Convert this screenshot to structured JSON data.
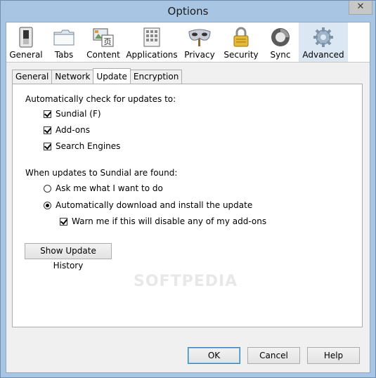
{
  "window": {
    "title": "Options",
    "close_label": "✕"
  },
  "panes": [
    {
      "label": "General",
      "icon": "switch-icon"
    },
    {
      "label": "Tabs",
      "icon": "folder-tabs-icon"
    },
    {
      "label": "Content",
      "icon": "content-icon"
    },
    {
      "label": "Applications",
      "icon": "applications-icon"
    },
    {
      "label": "Privacy",
      "icon": "mask-icon"
    },
    {
      "label": "Security",
      "icon": "padlock-icon"
    },
    {
      "label": "Sync",
      "icon": "sync-icon"
    },
    {
      "label": "Advanced",
      "icon": "gear-icon"
    }
  ],
  "selected_pane": "Advanced",
  "tabs": [
    "General",
    "Network",
    "Update",
    "Encryption"
  ],
  "active_tab": "Update",
  "update": {
    "auto_check_label": "Automatically check for updates to:",
    "check_items": [
      {
        "label": "Sundial (F)",
        "checked": true
      },
      {
        "label": "Add-ons",
        "checked": true
      },
      {
        "label": "Search Engines",
        "checked": true
      }
    ],
    "found_label": "When updates to Sundial are found:",
    "radio_ask": {
      "label": "Ask me what I want to do",
      "selected": false
    },
    "radio_auto": {
      "label": "Automatically download and install the update",
      "selected": true
    },
    "warn_checkbox": {
      "label": "Warn me if this will disable any of my add-ons",
      "checked": true
    },
    "history_button": "Show Update History"
  },
  "buttons": {
    "ok": "OK",
    "cancel": "Cancel",
    "help": "Help"
  },
  "watermark": "SOFTPEDIA",
  "colors": {
    "selected_pane_bg": "#dbe7f3",
    "frame": "#a8c6e4"
  }
}
